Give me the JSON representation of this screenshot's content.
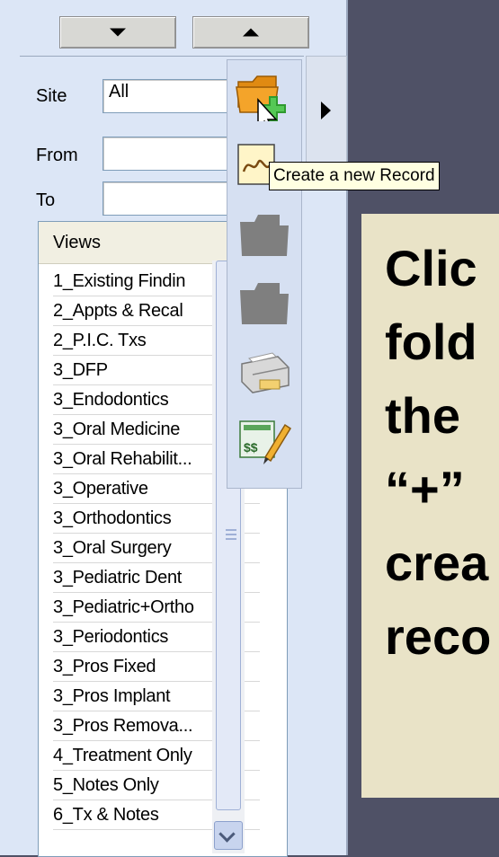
{
  "scroll_buttons": {
    "down_icon": "triangle-down",
    "up_icon": "triangle-up"
  },
  "filters": {
    "site_label": "Site",
    "site_value": "All",
    "from_label": "From",
    "from_value": "",
    "to_label": "To",
    "to_value": ""
  },
  "toolbar": {
    "icons": [
      "folder-plus-icon",
      "signature-icon",
      "disabled-folder-icon",
      "disabled-folder-icon",
      "printer-icon",
      "invoice-edit-icon"
    ]
  },
  "tooltip": {
    "text": "Create a new Record"
  },
  "views": {
    "header": "Views",
    "items": [
      "1_Existing Findin",
      "2_Appts & Recal",
      "2_P.I.C. Txs",
      "3_DFP",
      "3_Endodontics",
      "3_Oral Medicine",
      "3_Oral Rehabilit...",
      "3_Operative",
      "3_Orthodontics",
      "3_Oral Surgery",
      "3_Pediatric Dent",
      "3_Pediatric+Ortho",
      "3_Periodontics",
      "3_Pros Fixed",
      "3_Pros Implant",
      "3_Pros Remova...",
      "4_Treatment Only",
      "5_Notes Only",
      "6_Tx & Notes"
    ]
  },
  "instruction": {
    "lines": [
      "Clic",
      "fold",
      "the",
      "“+”",
      "crea",
      "reco"
    ]
  },
  "colors": {
    "background": "#4f5166",
    "panel": "#dce6f6",
    "note": "#e9e3c7",
    "tooltip": "#ffffe1"
  }
}
